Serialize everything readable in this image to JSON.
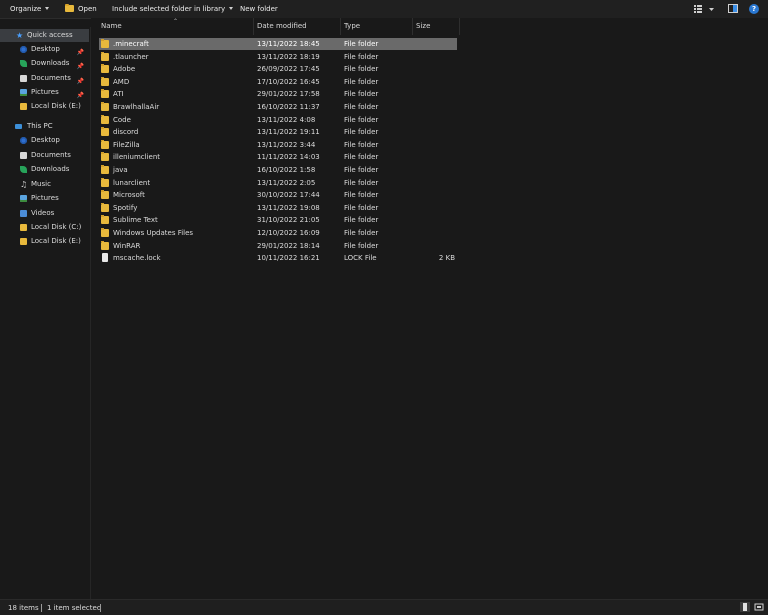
{
  "toolbar": {
    "organize": "Organize",
    "open": "Open",
    "include": "Include selected folder in library",
    "new_folder": "New folder",
    "help": "?"
  },
  "nav": {
    "quick_access": "Quick access",
    "quick_items": [
      {
        "label": "Desktop",
        "icon": "desktop-icon",
        "pinned": true
      },
      {
        "label": "Downloads",
        "icon": "downloads-icon",
        "pinned": true
      },
      {
        "label": "Documents",
        "icon": "documents-icon",
        "pinned": true
      },
      {
        "label": "Pictures",
        "icon": "pictures-icon",
        "pinned": true
      },
      {
        "label": "Local Disk (E:)",
        "icon": "disk-icon",
        "pinned": false
      }
    ],
    "this_pc": "This PC",
    "pc_items": [
      {
        "label": "Desktop",
        "icon": "desktop-icon"
      },
      {
        "label": "Documents",
        "icon": "documents-icon"
      },
      {
        "label": "Downloads",
        "icon": "downloads-icon"
      },
      {
        "label": "Music",
        "icon": "music-icon"
      },
      {
        "label": "Pictures",
        "icon": "pictures-icon"
      },
      {
        "label": "Videos",
        "icon": "videos-icon"
      },
      {
        "label": "Local Disk (C:)",
        "icon": "disk-icon"
      },
      {
        "label": "Local Disk (E:)",
        "icon": "disk-icon"
      }
    ]
  },
  "columns": {
    "name": "Name",
    "date": "Date modified",
    "type": "Type",
    "size": "Size"
  },
  "files": [
    {
      "name": ".minecraft",
      "date": "13/11/2022 18:45",
      "type": "File folder",
      "size": "",
      "kind": "folder",
      "selected": true
    },
    {
      "name": ".tlauncher",
      "date": "13/11/2022 18:19",
      "type": "File folder",
      "size": "",
      "kind": "folder"
    },
    {
      "name": "Adobe",
      "date": "26/09/2022 17:45",
      "type": "File folder",
      "size": "",
      "kind": "folder"
    },
    {
      "name": "AMD",
      "date": "17/10/2022 16:45",
      "type": "File folder",
      "size": "",
      "kind": "folder"
    },
    {
      "name": "ATI",
      "date": "29/01/2022 17:58",
      "type": "File folder",
      "size": "",
      "kind": "folder"
    },
    {
      "name": "BrawlhallaAir",
      "date": "16/10/2022 11:37",
      "type": "File folder",
      "size": "",
      "kind": "folder"
    },
    {
      "name": "Code",
      "date": "13/11/2022 4:08",
      "type": "File folder",
      "size": "",
      "kind": "folder"
    },
    {
      "name": "discord",
      "date": "13/11/2022 19:11",
      "type": "File folder",
      "size": "",
      "kind": "folder"
    },
    {
      "name": "FileZilla",
      "date": "13/11/2022 3:44",
      "type": "File folder",
      "size": "",
      "kind": "folder"
    },
    {
      "name": "illeniumclient",
      "date": "11/11/2022 14:03",
      "type": "File folder",
      "size": "",
      "kind": "folder"
    },
    {
      "name": "java",
      "date": "16/10/2022 1:58",
      "type": "File folder",
      "size": "",
      "kind": "folder"
    },
    {
      "name": "lunarclient",
      "date": "13/11/2022 2:05",
      "type": "File folder",
      "size": "",
      "kind": "folder"
    },
    {
      "name": "Microsoft",
      "date": "30/10/2022 17:44",
      "type": "File folder",
      "size": "",
      "kind": "folder"
    },
    {
      "name": "Spotify",
      "date": "13/11/2022 19:08",
      "type": "File folder",
      "size": "",
      "kind": "folder"
    },
    {
      "name": "Sublime Text",
      "date": "31/10/2022 21:05",
      "type": "File folder",
      "size": "",
      "kind": "folder"
    },
    {
      "name": "Windows Updates Files",
      "date": "12/10/2022 16:09",
      "type": "File folder",
      "size": "",
      "kind": "folder"
    },
    {
      "name": "WinRAR",
      "date": "29/01/2022 18:14",
      "type": "File folder",
      "size": "",
      "kind": "folder"
    },
    {
      "name": "mscache.lock",
      "date": "10/11/2022 16:21",
      "type": "LOCK File",
      "size": "2 KB",
      "kind": "file"
    }
  ],
  "status": {
    "items": "18 items",
    "selected": "1 item selected"
  },
  "colors": {
    "background": "#191919",
    "selection": "#6a6a6a",
    "folder": "#e8b93c",
    "accent": "#2a78d2"
  }
}
